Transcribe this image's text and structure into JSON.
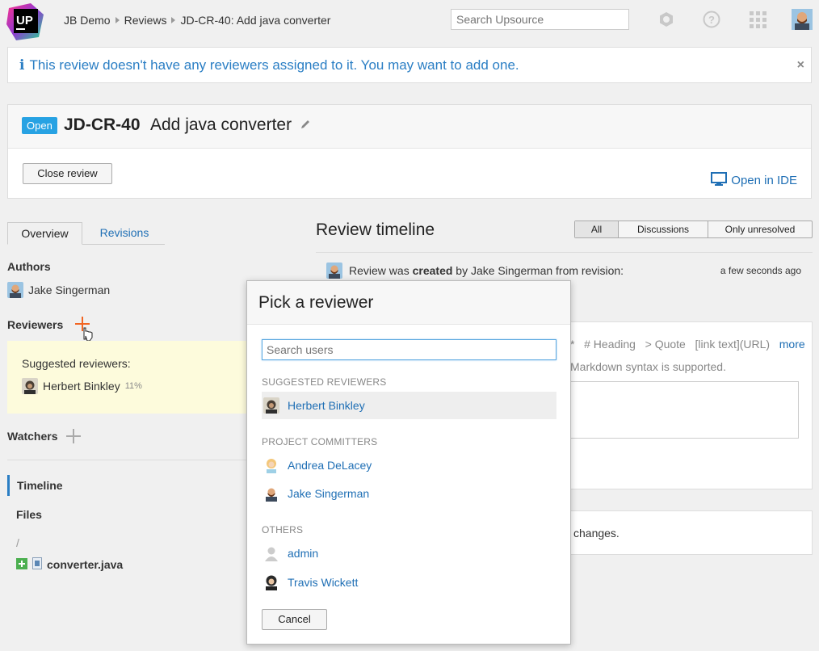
{
  "header": {
    "logo_text": "UP",
    "breadcrumb": [
      "JB Demo",
      "Reviews",
      "JD-CR-40: Add java converter"
    ],
    "search_placeholder": "Search Upsource"
  },
  "banner": {
    "text": "This review doesn't have any reviewers assigned to it. You may want to add one.",
    "close_glyph": "×"
  },
  "review": {
    "status": "Open",
    "id": "JD-CR-40",
    "title": "Add java converter",
    "close_label": "Close review",
    "open_ide_label": "Open in IDE"
  },
  "tabs": [
    "Overview",
    "Revisions"
  ],
  "authors": {
    "label": "Authors",
    "items": [
      "Jake Singerman"
    ]
  },
  "reviewers": {
    "label": "Reviewers",
    "suggested_label": "Suggested reviewers:",
    "suggested": [
      {
        "name": "Herbert Binkley",
        "percent": "11%"
      }
    ]
  },
  "watchers": {
    "label": "Watchers"
  },
  "nav": {
    "timeline": "Timeline",
    "files": "Files",
    "path": "/",
    "file": "converter.java"
  },
  "timeline": {
    "title": "Review timeline",
    "filters": [
      "All",
      "Discussions",
      "Only unresolved"
    ],
    "active_filter": "All",
    "event": {
      "prefix": "Review was",
      "action": "created",
      "suffix": "by Jake Singerman from revision:",
      "time": "a few seconds ago"
    },
    "markdown_hints": [
      "*",
      "# Heading",
      "> Quote",
      "[link text](URL)"
    ],
    "markdown_more": "more",
    "markdown_note": "Markdown syntax is supported.",
    "changes_text": "changes."
  },
  "modal": {
    "title": "Pick a reviewer",
    "search_placeholder": "Search users",
    "groups": [
      {
        "label": "SUGGESTED REVIEWERS",
        "users": [
          "Herbert Binkley"
        ]
      },
      {
        "label": "PROJECT COMMITTERS",
        "users": [
          "Andrea DeLacey",
          "Jake Singerman"
        ]
      },
      {
        "label": "OTHERS",
        "users": [
          "admin",
          "Travis Wickett"
        ]
      }
    ],
    "cancel_label": "Cancel"
  },
  "colors": {
    "accent": "#27a2e3",
    "link": "#1f6fb5",
    "add_orange": "#f26522",
    "suggest_bg": "#fdfbdc"
  }
}
